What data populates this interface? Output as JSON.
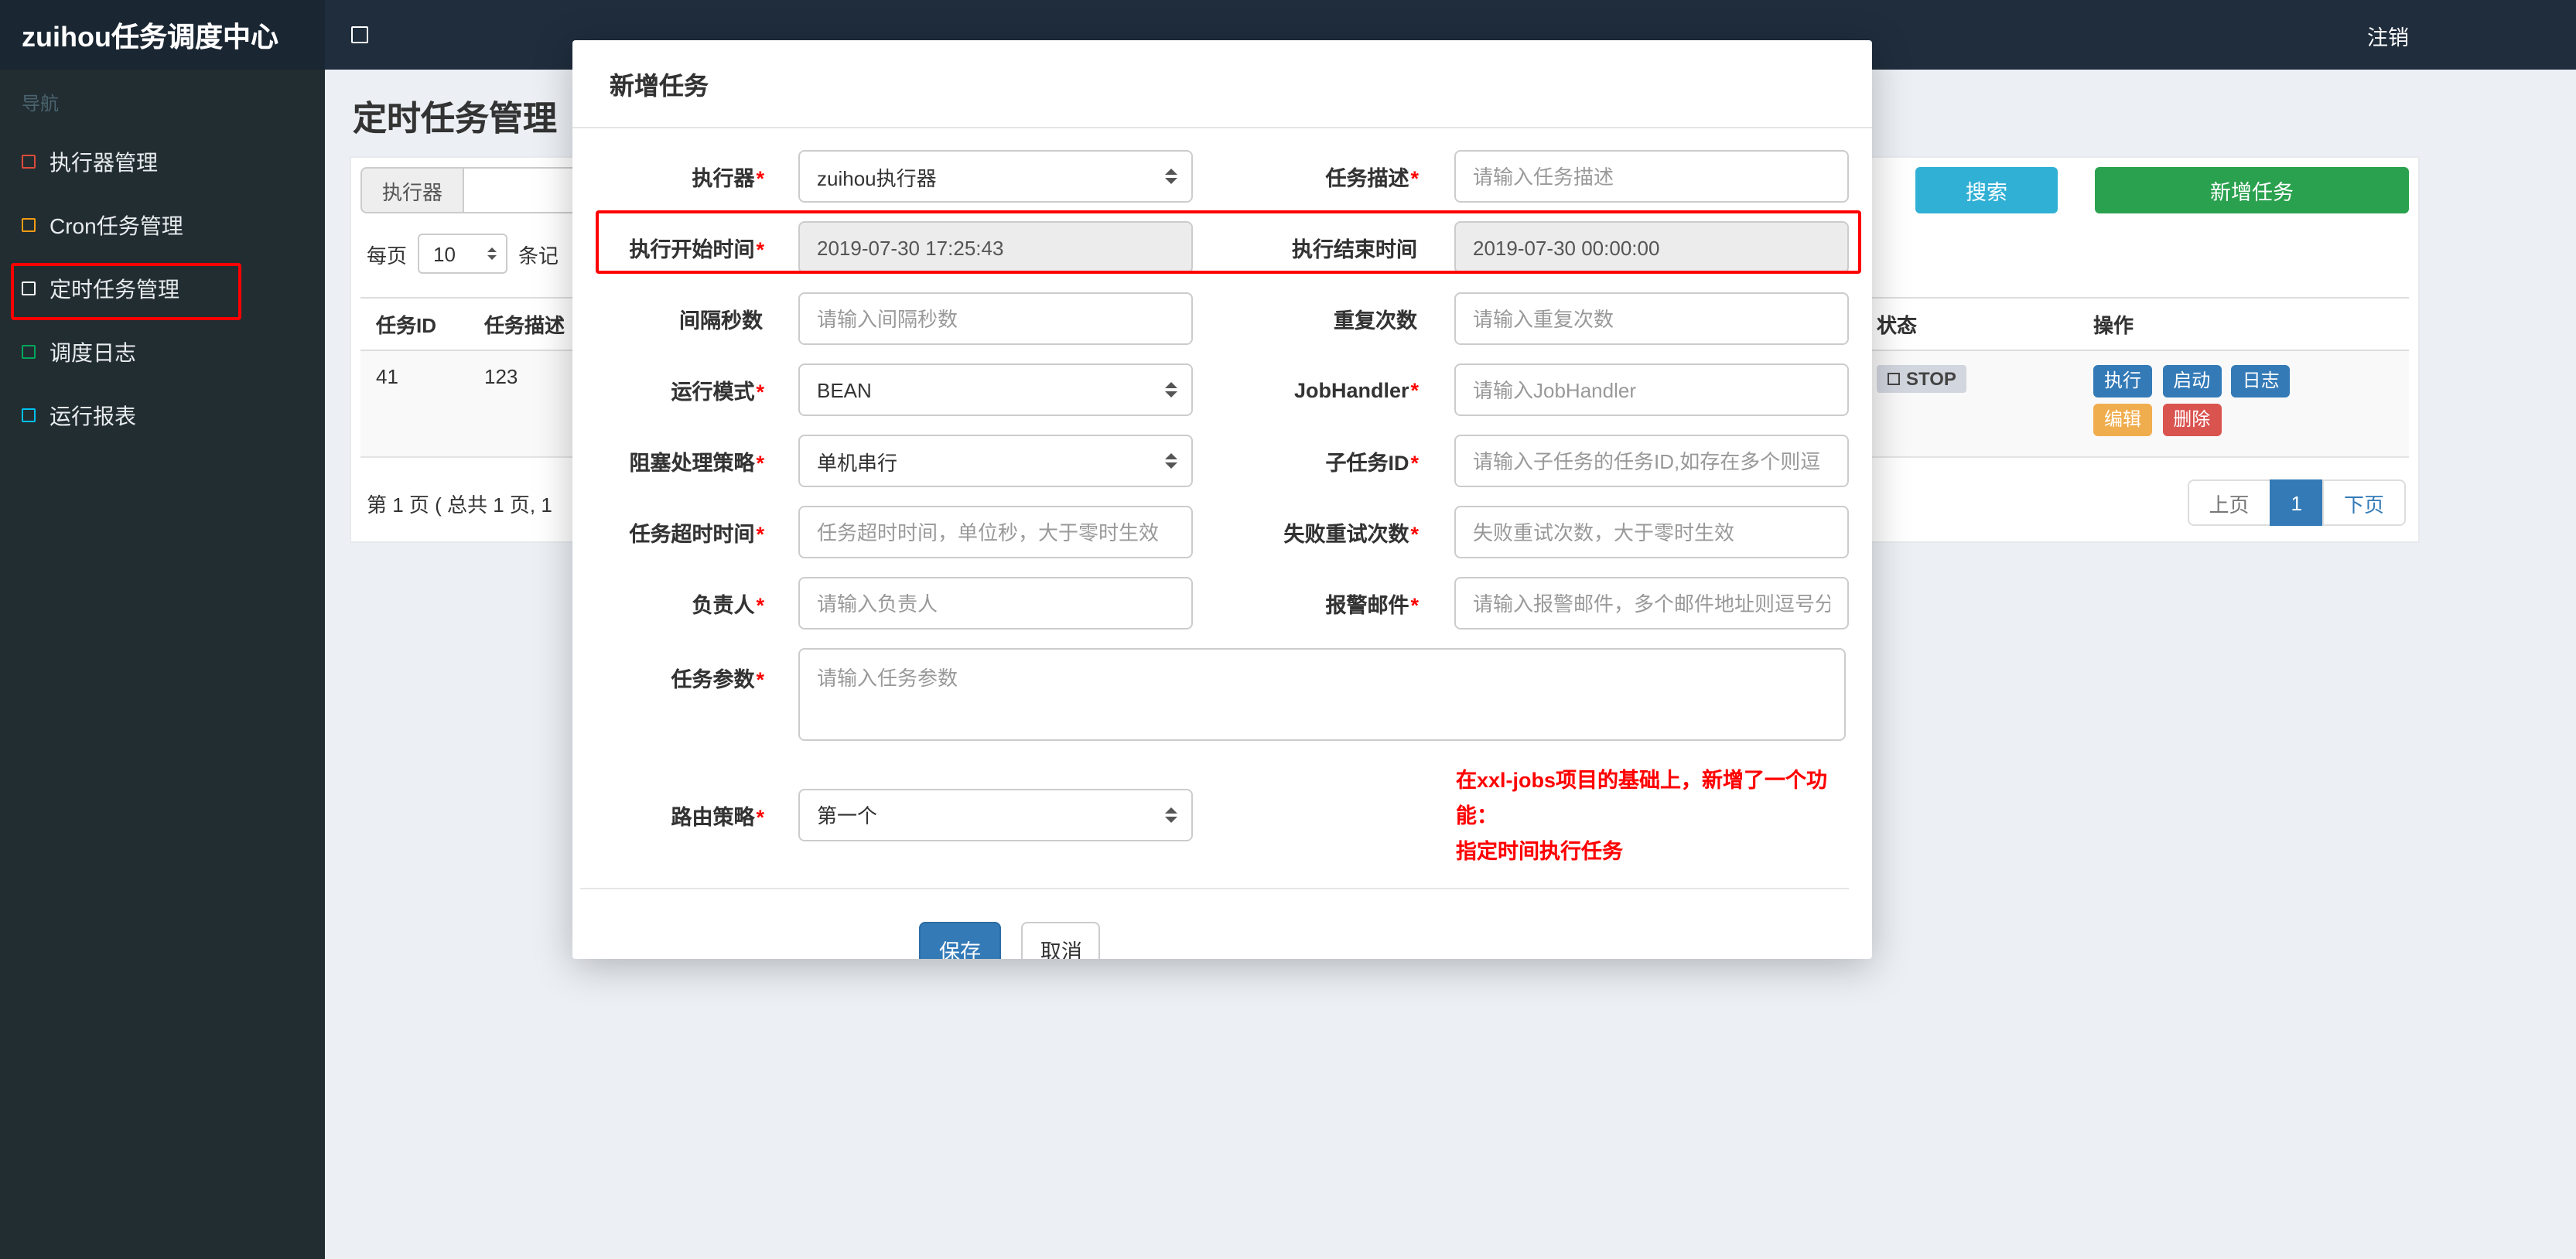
{
  "colors": {
    "navbar_bg": "#1f2d3d",
    "sidebar_bg": "#222d32",
    "accent_blue": "#337ab7",
    "search_button": "#31b0d5",
    "add_button": "#2aa14e",
    "warning_orange": "#f0ad4e",
    "danger_red": "#d9534f",
    "annotation_red": "#ff0000",
    "icon_red": "#dd4b39",
    "icon_orange": "#f39c12",
    "icon_white": "#ffffff",
    "icon_green": "#00a65a",
    "icon_cyan": "#00c0ef"
  },
  "navbar": {
    "brand": "zuihou任务调度中心",
    "logout": "注销"
  },
  "sidebar": {
    "header": "导航",
    "items": [
      {
        "label": "执行器管理"
      },
      {
        "label": "Cron任务管理"
      },
      {
        "label": "定时任务管理"
      },
      {
        "label": "调度日志"
      },
      {
        "label": "运行报表"
      }
    ]
  },
  "main": {
    "title": "定时任务管理",
    "filter": {
      "executor_label": "执行器",
      "search": "搜索",
      "add": "新增任务"
    },
    "per_page": {
      "prefix": "每页",
      "value": "10",
      "suffix": "条记"
    },
    "table": {
      "headers": [
        "任务ID",
        "任务描述",
        "状态",
        "操作"
      ],
      "row": {
        "id": "41",
        "desc": "123",
        "status": "STOP",
        "actions": [
          "执行",
          "启动",
          "日志",
          "编辑",
          "删除"
        ]
      }
    },
    "pagination": {
      "info": "第 1 页 ( 总共 1 页, 1",
      "prev": "上页",
      "current": "1",
      "next": "下页"
    }
  },
  "modal": {
    "title": "新增任务",
    "rows": [
      {
        "left": {
          "label": "执行器",
          "star": "*",
          "value": "zuihou执行器"
        },
        "right": {
          "label": "任务描述",
          "star": "*",
          "placeholder": "请输入任务描述"
        }
      },
      {
        "left": {
          "label": "执行开始时间",
          "star": "*",
          "value": "2019-07-30 17:25:43"
        },
        "right": {
          "label": "执行结束时间",
          "star": "",
          "value": "2019-07-30 00:00:00"
        }
      },
      {
        "left": {
          "label": "间隔秒数",
          "star": "",
          "placeholder": "请输入间隔秒数"
        },
        "right": {
          "label": "重复次数",
          "star": "",
          "placeholder": "请输入重复次数"
        }
      },
      {
        "left": {
          "label": "运行模式",
          "star": "*",
          "value": "BEAN"
        },
        "right": {
          "label": "JobHandler",
          "star": "*",
          "placeholder": "请输入JobHandler"
        }
      },
      {
        "left": {
          "label": "阻塞处理策略",
          "star": "*",
          "value": "单机串行"
        },
        "right": {
          "label": "子任务ID",
          "star": "*",
          "placeholder": "请输入子任务的任务ID,如存在多个则逗"
        }
      },
      {
        "left": {
          "label": "任务超时时间",
          "star": "*",
          "placeholder": "任务超时时间，单位秒，大于零时生效"
        },
        "right": {
          "label": "失败重试次数",
          "star": "*",
          "placeholder": "失败重试次数，大于零时生效"
        }
      },
      {
        "left": {
          "label": "负责人",
          "star": "*",
          "placeholder": "请输入负责人"
        },
        "right": {
          "label": "报警邮件",
          "star": "*",
          "placeholder": "请输入报警邮件，多个邮件地址则逗号分"
        }
      }
    ],
    "params": {
      "label": "任务参数",
      "star": "*",
      "placeholder": "请输入任务参数"
    },
    "route": {
      "label": "路由策略",
      "star": "*",
      "value": "第一个"
    },
    "note_line1": "在xxl-jobs项目的基础上，新增了一个功能：",
    "note_line2": "指定时间执行任务",
    "save": "保存",
    "cancel": "取消"
  }
}
